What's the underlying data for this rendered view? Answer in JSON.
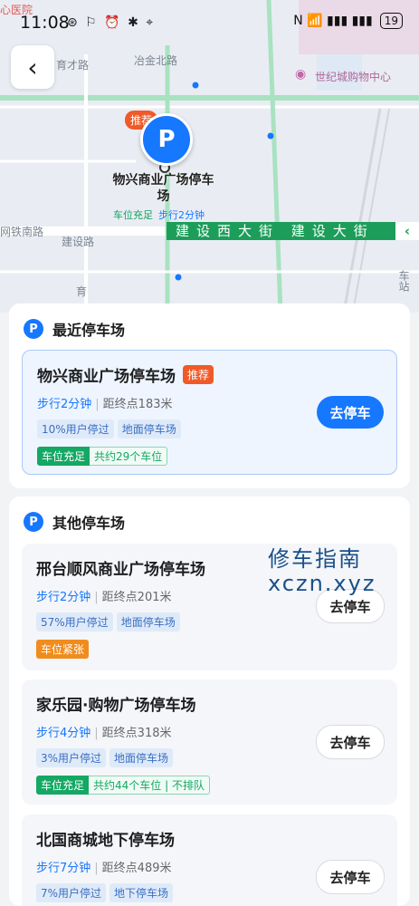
{
  "status_bar": {
    "time": "11:08",
    "icons": "⊛ ⚐ ⏰ ✱ ⌖",
    "right_icons": "N 📶 ▮▮▮ ▮▮▮",
    "battery": "19"
  },
  "map": {
    "labels": {
      "hospital": "心医院",
      "yucai": "育才路",
      "yejin": "冶金北路",
      "mall": "世纪城购物中心",
      "railway": "网铁南路",
      "jianshe": "建设路",
      "yu": "育",
      "station": "车站"
    },
    "street_band": "建设西大街  建设大街",
    "pin": {
      "badge": "推荐",
      "name": "物兴商业广场停车场",
      "availability": "车位充足",
      "walk": "步行2分钟"
    }
  },
  "nearest": {
    "title": "最近停车场",
    "lot": {
      "name": "物兴商业广场停车场",
      "badge": "推荐",
      "walk": "步行2分钟",
      "distance": "距终点183米",
      "tags": [
        "10%用户停过",
        "地面停车场"
      ],
      "status": "车位充足",
      "status_info": "共约29个车位",
      "button": "去停车"
    }
  },
  "others": {
    "title": "其他停车场",
    "lots": [
      {
        "name": "邢台顺风商业广场停车场",
        "walk": "步行2分钟",
        "distance": "距终点201米",
        "tags": [
          "57%用户停过",
          "地面停车场"
        ],
        "status": "车位紧张",
        "status_info": "",
        "button": "去停车"
      },
      {
        "name": "家乐园·购物广场停车场",
        "walk": "步行4分钟",
        "distance": "距终点318米",
        "tags": [
          "3%用户停过",
          "地面停车场"
        ],
        "status": "车位充足",
        "status_info": "共约44个车位 | 不排队",
        "button": "去停车"
      },
      {
        "name": "北国商城地下停车场",
        "walk": "步行7分钟",
        "distance": "距终点489米",
        "tags": [
          "7%用户停过",
          "地下停车场"
        ],
        "status": "",
        "status_info": "",
        "button": "去停车"
      }
    ]
  },
  "watermark": {
    "line1": "修车指南",
    "line2": "xczn.xyz"
  },
  "colors": {
    "primary": "#1677ff",
    "green": "#14a864",
    "orange": "#f05a28",
    "amber": "#f08c1e"
  }
}
